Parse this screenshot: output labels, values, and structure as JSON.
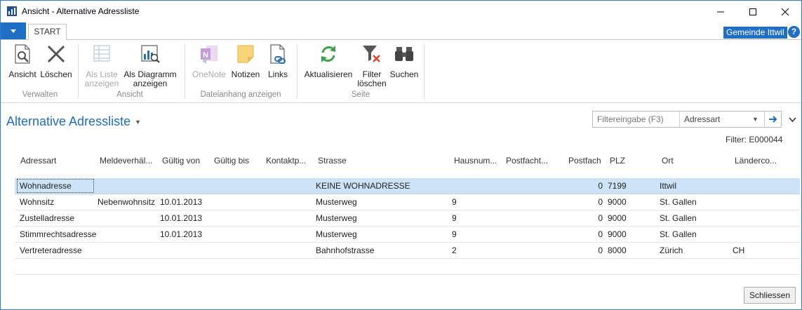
{
  "window": {
    "title": "Ansicht - Alternative Adressliste"
  },
  "ribbon": {
    "tab": "START",
    "tenant": "Gemeinde Ittwil",
    "help": "?",
    "buttons": {
      "ansicht": "Ansicht",
      "loeschen": "Löschen",
      "als_liste": [
        "Als Liste",
        "anzeigen"
      ],
      "als_diagramm": [
        "Als Diagramm",
        "anzeigen"
      ],
      "onenote": "OneNote",
      "notizen": "Notizen",
      "links": "Links",
      "aktualisieren": "Aktualisieren",
      "filter_loeschen": [
        "Filter",
        "löschen"
      ],
      "suchen": "Suchen"
    },
    "groups": {
      "verwalten": "Verwalten",
      "ansicht": "Ansicht",
      "dateianhang": "Dateianhang anzeigen",
      "seite": "Seite"
    }
  },
  "page": {
    "title": "Alternative Adressliste",
    "filter_placeholder": "Filtereingabe (F3)",
    "filter_field": "Adressart",
    "filter_info": "Filter: E000044"
  },
  "table": {
    "columns": [
      "Adressart",
      "Meldeverhäl...",
      "Gültig von",
      "Gültig bis",
      "Kontaktp...",
      "Strasse",
      "Hausnum...",
      "Postfacht...",
      "Postfach",
      "PLZ",
      "Ort",
      "Länderco..."
    ],
    "rows": [
      {
        "adressart": "Wohnadresse",
        "meldeverhaeltnis": "",
        "gueltig_von": "",
        "gueltig_bis": "",
        "kontaktperson": "",
        "strasse": "KEINE WOHNADRESSE",
        "hausnummer": "",
        "postfachtext": "",
        "postfach": "0",
        "plz": "7199",
        "ort": "Ittwil",
        "laendercode": ""
      },
      {
        "adressart": "Wohnsitz",
        "meldeverhaeltnis": "Nebenwohnsitz",
        "gueltig_von": "10.01.2013",
        "gueltig_bis": "",
        "kontaktperson": "",
        "strasse": "Musterweg",
        "hausnummer": "9",
        "postfachtext": "",
        "postfach": "0",
        "plz": "9000",
        "ort": "St. Gallen",
        "laendercode": ""
      },
      {
        "adressart": "Zustelladresse",
        "meldeverhaeltnis": "",
        "gueltig_von": "10.01.2013",
        "gueltig_bis": "",
        "kontaktperson": "",
        "strasse": "Musterweg",
        "hausnummer": "9",
        "postfachtext": "",
        "postfach": "0",
        "plz": "9000",
        "ort": "St. Gallen",
        "laendercode": ""
      },
      {
        "adressart": "Stimmrechtsadresse",
        "meldeverhaeltnis": "",
        "gueltig_von": "10.01.2013",
        "gueltig_bis": "",
        "kontaktperson": "",
        "strasse": "Musterweg",
        "hausnummer": "9",
        "postfachtext": "",
        "postfach": "0",
        "plz": "9000",
        "ort": "St. Gallen",
        "laendercode": ""
      },
      {
        "adressart": "Vertreteradresse",
        "meldeverhaeltnis": "",
        "gueltig_von": "",
        "gueltig_bis": "",
        "kontaktperson": "",
        "strasse": "Bahnhofstrasse",
        "hausnummer": "2",
        "postfachtext": "",
        "postfach": "0",
        "plz": "8000",
        "ort": "Zürich",
        "laendercode": "CH"
      }
    ]
  },
  "footer": {
    "close_label": "Schliessen"
  },
  "colors": {
    "accent": "#1e6fc5",
    "selected_row": "#cde3f7"
  }
}
